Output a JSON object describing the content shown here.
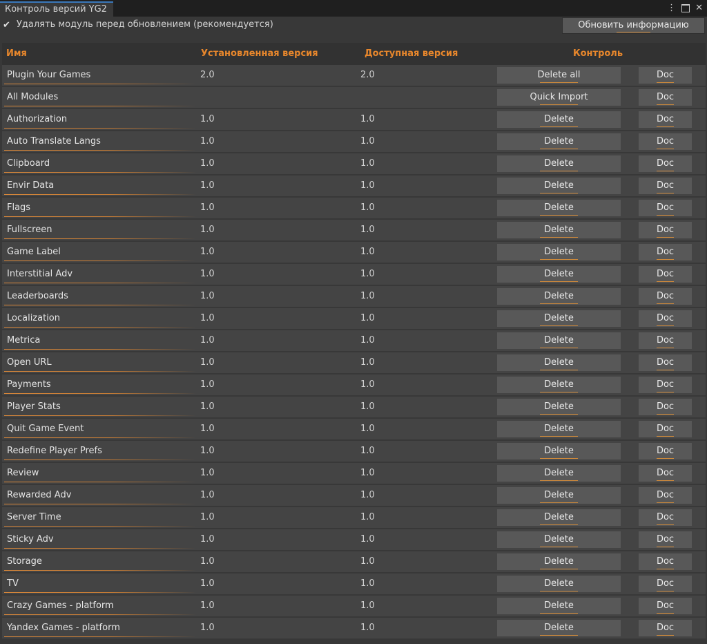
{
  "window": {
    "tab_title": "Контроль версий YG2",
    "menu_icon": "kebab-menu-icon",
    "maximize_icon": "maximize-icon",
    "close_icon": "close-icon"
  },
  "options": {
    "delete_before_update_checked": true,
    "delete_before_update_label": "Удалять модуль перед обновлением (рекомендуется)",
    "refresh_label": "Обновить информацию"
  },
  "table": {
    "headers": {
      "name": "Имя",
      "installed": "Установленная версия",
      "available": "Доступная версия",
      "control": "Контроль"
    },
    "rows": [
      {
        "name": "Plugin Your Games",
        "installed": "2.0",
        "available": "2.0",
        "action": "Delete all",
        "doc": "Doc"
      },
      {
        "name": "All Modules",
        "installed": "",
        "available": "",
        "action": "Quick Import",
        "doc": "Doc"
      },
      {
        "name": "Authorization",
        "installed": "1.0",
        "available": "1.0",
        "action": "Delete",
        "doc": "Doc"
      },
      {
        "name": "Auto Translate Langs",
        "installed": "1.0",
        "available": "1.0",
        "action": "Delete",
        "doc": "Doc"
      },
      {
        "name": "Clipboard",
        "installed": "1.0",
        "available": "1.0",
        "action": "Delete",
        "doc": "Doc"
      },
      {
        "name": "Envir Data",
        "installed": "1.0",
        "available": "1.0",
        "action": "Delete",
        "doc": "Doc"
      },
      {
        "name": "Flags",
        "installed": "1.0",
        "available": "1.0",
        "action": "Delete",
        "doc": "Doc"
      },
      {
        "name": "Fullscreen",
        "installed": "1.0",
        "available": "1.0",
        "action": "Delete",
        "doc": "Doc"
      },
      {
        "name": "Game Label",
        "installed": "1.0",
        "available": "1.0",
        "action": "Delete",
        "doc": "Doc"
      },
      {
        "name": "Interstitial Adv",
        "installed": "1.0",
        "available": "1.0",
        "action": "Delete",
        "doc": "Doc"
      },
      {
        "name": "Leaderboards",
        "installed": "1.0",
        "available": "1.0",
        "action": "Delete",
        "doc": "Doc"
      },
      {
        "name": "Localization",
        "installed": "1.0",
        "available": "1.0",
        "action": "Delete",
        "doc": "Doc"
      },
      {
        "name": "Metrica",
        "installed": "1.0",
        "available": "1.0",
        "action": "Delete",
        "doc": "Doc"
      },
      {
        "name": "Open URL",
        "installed": "1.0",
        "available": "1.0",
        "action": "Delete",
        "doc": "Doc"
      },
      {
        "name": "Payments",
        "installed": "1.0",
        "available": "1.0",
        "action": "Delete",
        "doc": "Doc"
      },
      {
        "name": "Player Stats",
        "installed": "1.0",
        "available": "1.0",
        "action": "Delete",
        "doc": "Doc"
      },
      {
        "name": "Quit Game Event",
        "installed": "1.0",
        "available": "1.0",
        "action": "Delete",
        "doc": "Doc"
      },
      {
        "name": "Redefine Player Prefs",
        "installed": "1.0",
        "available": "1.0",
        "action": "Delete",
        "doc": "Doc"
      },
      {
        "name": "Review",
        "installed": "1.0",
        "available": "1.0",
        "action": "Delete",
        "doc": "Doc"
      },
      {
        "name": "Rewarded Adv",
        "installed": "1.0",
        "available": "1.0",
        "action": "Delete",
        "doc": "Doc"
      },
      {
        "name": "Server Time",
        "installed": "1.0",
        "available": "1.0",
        "action": "Delete",
        "doc": "Doc"
      },
      {
        "name": "Sticky Adv",
        "installed": "1.0",
        "available": "1.0",
        "action": "Delete",
        "doc": "Doc"
      },
      {
        "name": "Storage",
        "installed": "1.0",
        "available": "1.0",
        "action": "Delete",
        "doc": "Doc"
      },
      {
        "name": "TV",
        "installed": "1.0",
        "available": "1.0",
        "action": "Delete",
        "doc": "Doc"
      },
      {
        "name": "Crazy Games - platform",
        "installed": "1.0",
        "available": "1.0",
        "action": "Delete",
        "doc": "Doc"
      },
      {
        "name": "Yandex Games - platform",
        "installed": "1.0",
        "available": "1.0",
        "action": "Delete",
        "doc": "Doc"
      }
    ]
  },
  "colors": {
    "background": "#383838",
    "row_background": "#444444",
    "button": "#585858",
    "accent_orange": "#e8872c",
    "tab_accent": "#3a79bb"
  }
}
